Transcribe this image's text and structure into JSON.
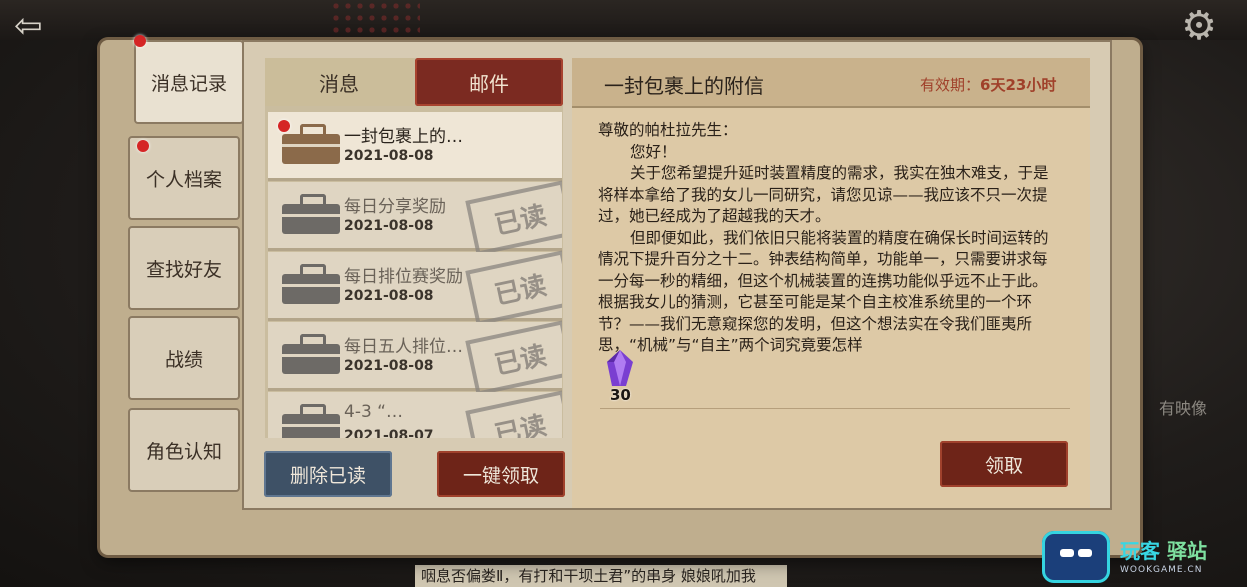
{
  "sidebar": {
    "items": [
      {
        "label": "消息记录",
        "active": true,
        "badge": true
      },
      {
        "label": "个人档案",
        "active": false,
        "badge": true
      },
      {
        "label": "查找好友",
        "active": false,
        "badge": false
      },
      {
        "label": "战绩",
        "active": false,
        "badge": false
      },
      {
        "label": "角色认知",
        "active": false,
        "badge": false
      }
    ]
  },
  "tabs": [
    {
      "label": "消息",
      "active": false
    },
    {
      "label": "邮件",
      "active": true
    }
  ],
  "mails": [
    {
      "title": "一封包裹上的…",
      "date": "2021-08-08",
      "read": false,
      "selected": true
    },
    {
      "title": "每日分享奖励",
      "date": "2021-08-08",
      "read": true,
      "selected": false
    },
    {
      "title": "每日排位赛奖励",
      "date": "2021-08-08",
      "read": true,
      "selected": false
    },
    {
      "title": "每日五人排位…",
      "date": "2021-08-08",
      "read": true,
      "selected": false
    },
    {
      "title": "4-3 “…",
      "date": "2021-08-07",
      "read": true,
      "selected": false
    }
  ],
  "read_stamp": "已读",
  "buttons": {
    "delete_read": "删除已读",
    "claim_all": "一键领取",
    "claim": "领取"
  },
  "detail": {
    "title": "一封包裹上的附信",
    "expiry_label": "有效期：",
    "expiry_value": "6天23小时",
    "letter": [
      "尊敬的帕杜拉先生：",
      "您好！",
      "关于您希望提升延时装置精度的需求，我实在独木难支，于是将样本拿给了我的女儿一同研究，请您见谅——我应该不只一次提过，她已经成为了超越我的天才。",
      "但即便如此，我们依旧只能将装置的精度在确保长时间运转的情况下提升百分之十二。钟表结构简单，功能单一，只需要讲求每一分每一秒的精细，但这个机械装置的连携功能似乎远不止于此。根据我女儿的猜测，它甚至可能是某个自主校准系统里的一个环节？——我们无意窥探您的发明，但这个想法实在令我们匪夷所思，“机械”与“自主”两个词究竟要怎样"
    ],
    "reward_count": "30",
    "reward_icon": "purple-crystal-icon"
  },
  "background": {
    "right_label": "有映像",
    "bottom_text": "咽息否偏娄Ⅱ，有打和干坝土君”的串身 娘娘吼加我"
  },
  "watermark": {
    "name_a": "玩客",
    "name_b": "驿站",
    "url": "WOOKGAME.CN"
  },
  "colors": {
    "accent_red": "#7b2a21",
    "badge_red": "#d52525",
    "expiry_red": "#a0402a",
    "delete_blue": "#3e5166"
  }
}
